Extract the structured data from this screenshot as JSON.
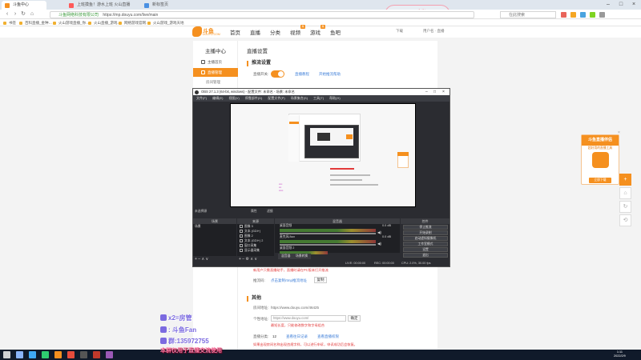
{
  "browser": {
    "tabs": [
      {
        "label": "斗鱼中心",
        "active": true
      },
      {
        "label": "上班摸鱼！游水上班 火山直播平台",
        "active": false
      },
      {
        "label": "新标签页",
        "active": false
      }
    ],
    "sticker": "国楼",
    "address": {
      "secure_label": "斗鱼网络科技有限公司",
      "url": "https://mp.douyu.com/live/main"
    },
    "search_placeholder": "在此搜索",
    "bookmarks": [
      "书签",
      "百科直播_金种…",
      "火山游戏直播_你…",
      "火山直播_游戏…",
      "网络游戏官网…",
      "火山游戏_游戏天地",
      "抖音直播_金种…",
      "首播直播_金种…"
    ]
  },
  "site": {
    "logo_text": "斗鱼",
    "logo_sub": "DOUYU.COM",
    "nav": [
      "首页",
      "直播",
      "分类",
      "视频",
      "游戏",
      "鱼吧"
    ],
    "hot_badge": "热",
    "header_right": [
      "下载",
      "用户名 · 直播"
    ]
  },
  "left_nav": {
    "title": "主播中心",
    "items": [
      {
        "label": "主播首页",
        "active": false
      },
      {
        "label": "直播管理",
        "active": true
      }
    ],
    "sub_items": [
      "房间管理"
    ]
  },
  "content": {
    "breadcrumb": "直播设置",
    "section1": "推流设置",
    "live_switch_label": "直播开关:",
    "link_a": "直播教程",
    "link_b": "开始推流帮助",
    "note_link": "新用户只需直播助手，直播时请在PC版本打开推流",
    "rtmp_label": "推流码:",
    "rtmp_link": "点击复制rtmp推流地址",
    "copy_btn": "复制",
    "section2": "其他",
    "room_url_label": "房间地址:",
    "room_url": "https://www.douyu.com/46425",
    "short_label": "个性地址:",
    "short_value": "https://www.douyu.com/",
    "short_btn": "确定",
    "short_note": "最短长度，只能修改数字和字母组合",
    "level_label": "直播分类:",
    "level_value": "12",
    "level_link_a": "查看往日记录",
    "level_link_b": "查看直播权限",
    "warn1": "如果出现房间名称出现违规字样，可以进行申诉，申诉成功后会恢复。",
    "warn2": "直播封面，不能出现违规内容。"
  },
  "obs": {
    "title": "OBS 27.1.3 (64-bit, windows) - 配置文件: 未命名 - 场景: 未命名",
    "menu": [
      "文件(F)",
      "编辑(E)",
      "视图(V)",
      "停靠部件(D)",
      "配置文件(P)",
      "场景集合(S)",
      "工具(T)",
      "帮助(H)"
    ],
    "lower_label_left": "未选择源",
    "props_btn": "属性",
    "filters_btn": "滤镜",
    "docks": [
      "场景",
      "来源",
      "混音器",
      "转场",
      "控件"
    ],
    "scene_name": "场景",
    "sources": [
      "图像 3",
      "文本 (GDI+)",
      "图像 2",
      "文本 (GDI+) 2",
      "窗口采集",
      "显示器采集"
    ],
    "mixer": [
      {
        "label": "桌面音频",
        "db": "0.0 dB"
      },
      {
        "label": "麦克风/Aux",
        "db": "0.0 dB"
      },
      {
        "label": "桌面音频 2",
        "db": "0.0 dB"
      }
    ],
    "tabs": [
      "混音器",
      "场景转换"
    ],
    "controls": [
      "停止推流",
      "开始录制",
      "启动虚拟摄像机",
      "工作室模式",
      "设置",
      "退出"
    ],
    "status": [
      "LIVE: 00:00:00",
      "REC: 00:00:00",
      "CPU: 2.0%, 30.00 fps"
    ]
  },
  "promo": {
    "header": "斗鱼直播伴侣",
    "sub": "超好用的直播工具",
    "download": "立即下载"
  },
  "side_buttons": [
    "+",
    "⌂",
    "↻",
    "⟲"
  ],
  "overlay": {
    "line1": "x2=房管",
    "line2": ": 斗鱼Fan",
    "line3": "群:135972755",
    "line4": "本群仅用于直播交流使用"
  },
  "taskbar": {
    "time": "1:11",
    "date": "2022/2/9"
  },
  "colors": {
    "accent": "#f5901f",
    "link": "#3f7fd8",
    "warn": "#e23a3a"
  }
}
